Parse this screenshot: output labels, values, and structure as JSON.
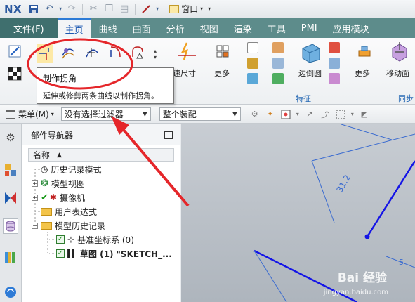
{
  "app": {
    "logo": "NX"
  },
  "quick_access": {
    "window_label": "窗口"
  },
  "tabs": [
    {
      "label": "文件(F)"
    },
    {
      "label": "主页"
    },
    {
      "label": "曲线"
    },
    {
      "label": "曲面"
    },
    {
      "label": "分析"
    },
    {
      "label": "视图"
    },
    {
      "label": "渲染"
    },
    {
      "label": "工具"
    },
    {
      "label": "PMI"
    },
    {
      "label": "应用模块"
    }
  ],
  "ribbon": {
    "quick_dim_label": "速尺寸",
    "more_label_1": "更多",
    "edge_blend_label": "边倒圆",
    "more_label_2": "更多",
    "move_face_label": "移动面",
    "feature_group": "特征",
    "sync_group": "同步"
  },
  "tooltip": {
    "title": "制作拐角",
    "description": "延伸或修剪两条曲线以制作拐角。"
  },
  "selection_bar": {
    "menu_label": "菜单(M)",
    "filter_value": "没有选择过滤器",
    "assembly_value": "整个装配"
  },
  "navigator": {
    "title": "部件导航器",
    "column_name": "名称",
    "items": [
      {
        "label": "历史记录模式"
      },
      {
        "label": "模型视图"
      },
      {
        "label": "摄像机"
      },
      {
        "label": "用户表达式"
      },
      {
        "label": "模型历史记录"
      },
      {
        "label": "基准坐标系 (0)"
      },
      {
        "label": "草图 (1) \"SKETCH_..."
      }
    ]
  },
  "graphics": {
    "dim_1": "31.2",
    "dim_2": "5"
  },
  "watermark": {
    "brand": "Bai 经验",
    "url": "jingyan.baidu.com"
  },
  "colors": {
    "tab_bar": "#5d8c8b",
    "accent": "#1a56b0",
    "annotation_red": "#e5262a",
    "sketch_line": "#1a1aee"
  }
}
